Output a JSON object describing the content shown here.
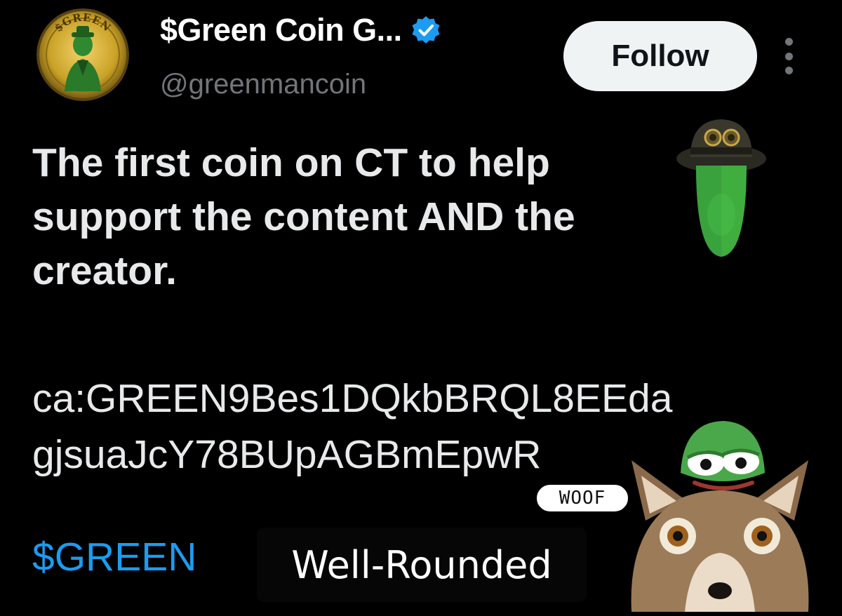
{
  "header": {
    "display_name": "$Green Coin G...",
    "handle": "@greenmancoin",
    "follow_label": "Follow",
    "verified_icon": "verified-badge-icon",
    "more_icon": "more-options-icon",
    "avatar_text": "$GREEN"
  },
  "tweet": {
    "text_lines": [
      "The first coin on CT to help",
      "support the content AND the",
      "creator."
    ],
    "contract_lines": [
      "ca:GREEN9Bes1DQkbBRQL8EEda",
      "gjsuaJcY78BUpAGBmEpwR"
    ],
    "cashtag": "$GREEN"
  },
  "overlays": {
    "caption": "Well-Rounded",
    "woof": "WOOF"
  },
  "colors": {
    "background": "#000000",
    "text": "#e7e9ea",
    "muted": "#71767b",
    "link": "#1d9bf0",
    "verified": "#1d9bf0",
    "follow_bg": "#eff3f4",
    "coin_gold": "#c9a227",
    "mask_green": "#3fae3f"
  }
}
